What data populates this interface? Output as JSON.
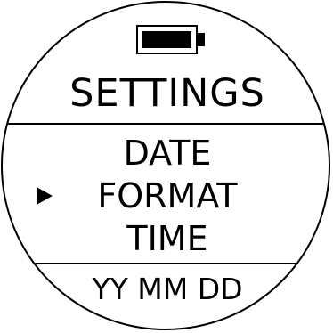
{
  "status": {
    "battery_icon": "battery-full-icon",
    "battery_level": 1.0
  },
  "screen": {
    "title": "SETTINGS",
    "menu": {
      "items": [
        "DATE",
        "FORMAT",
        "TIME"
      ],
      "selected_index": 1,
      "selector_icon": "play-icon"
    },
    "current_value": "YY MM DD"
  },
  "colors": {
    "foreground": "#000000",
    "background": "#ffffff"
  }
}
